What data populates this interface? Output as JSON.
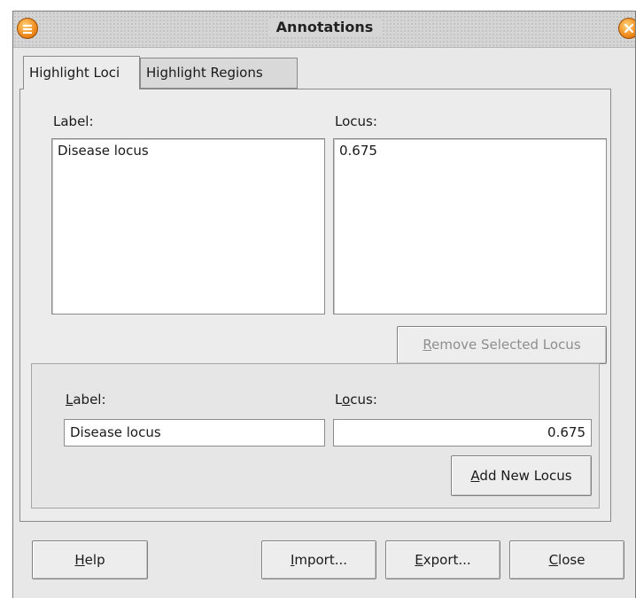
{
  "window": {
    "title": "Annotations"
  },
  "tabs": [
    {
      "label": "Highlight Loci",
      "active": true
    },
    {
      "label": "Highlight Regions",
      "active": false
    }
  ],
  "lists": {
    "label_header": "Label:",
    "locus_header": "Locus:",
    "label_items": [
      "Disease locus"
    ],
    "locus_items": [
      "0.675"
    ]
  },
  "remove_button": {
    "prefix": "",
    "mnemonic": "R",
    "rest": "emove Selected Locus",
    "enabled": false
  },
  "new_entry": {
    "label_mnemonic": "L",
    "label_rest": "abel:",
    "locus_pre": "L",
    "locus_mnemonic": "o",
    "locus_rest": "cus:",
    "label_value": "Disease locus",
    "locus_value": "0.675"
  },
  "add_button": {
    "mnemonic": "A",
    "rest": "dd New Locus"
  },
  "footer_buttons": {
    "help": {
      "mnemonic": "H",
      "rest": "elp"
    },
    "import": {
      "mnemonic": "I",
      "rest": "mport..."
    },
    "export": {
      "mnemonic": "E",
      "rest": "xport..."
    },
    "close": {
      "mnemonic": "C",
      "rest": "lose"
    }
  },
  "colors": {
    "titlebar_button": "#f08a1c",
    "window_bg": "#e8e8e8"
  }
}
